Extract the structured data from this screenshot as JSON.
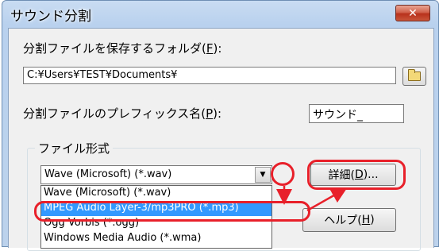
{
  "window": {
    "title": "サウンド分割",
    "close_label": "✕"
  },
  "folder": {
    "label_text": "分割ファイルを保存するフォルダ(",
    "label_key": "F",
    "label_suffix": "):",
    "value": "C:¥Users¥TEST¥Documents¥"
  },
  "prefix": {
    "label_text": "分割ファイルのプレフィックス名(",
    "label_key": "P",
    "label_suffix": "):",
    "value": "サウンド_"
  },
  "format": {
    "group_label": "ファイル形式",
    "selected": "Wave (Microsoft) (*.wav)",
    "options": [
      "Wave (Microsoft) (*.wav)",
      "MPEG Audio Layer-3/mp3PRO (*.mp3)",
      "Ogg Vorbis (*.ogg)",
      "Windows Media Audio (*.wma)"
    ],
    "highlighted_index": 1
  },
  "buttons": {
    "detail_text": "詳細(",
    "detail_key": "D",
    "detail_suffix": ")...",
    "help_text": "ヘルプ(",
    "help_key": "H",
    "help_suffix": ")"
  },
  "annotation_color": "#e8202a",
  "icons": {
    "browse": "folder-icon",
    "dropdown": "chevron-down-icon"
  }
}
